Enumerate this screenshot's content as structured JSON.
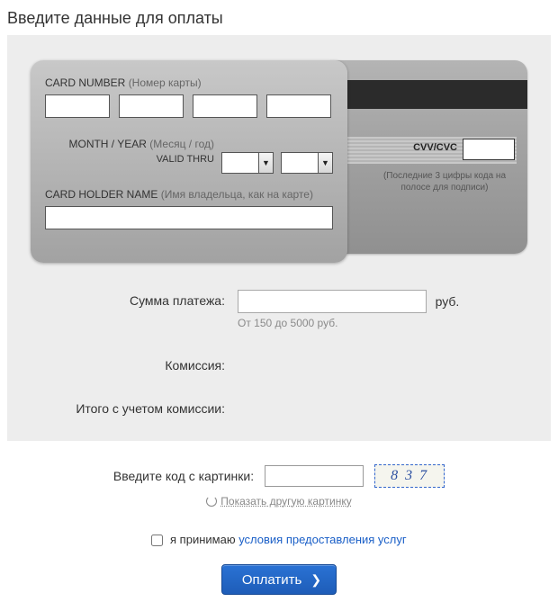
{
  "title": "Введите данные для оплаты",
  "card": {
    "number_label": "CARD NUMBER",
    "number_label_paren": "(Номер карты)",
    "number_parts": [
      "",
      "",
      "",
      ""
    ],
    "month_year_label": "MONTH / YEAR",
    "month_year_paren": "(Месяц / год)",
    "valid_thru": "VALID\nTHRU",
    "month_value": "",
    "year_value": "",
    "holder_label": "CARD HOLDER NAME",
    "holder_paren": "(Имя владельца, как на карте)",
    "holder_value": "",
    "cvv_label": "CVV/CVC",
    "cvv_value": "",
    "cvv_hint": "(Последние 3 цифры кода на полосе для подписи)"
  },
  "amount": {
    "label": "Сумма платежа:",
    "value": "",
    "currency": "руб.",
    "hint": "От 150 до 5000 руб."
  },
  "commission_label": "Комиссия:",
  "total_label": "Итого с учетом комиссии:",
  "captcha": {
    "label": "Введите код с картинки:",
    "value": "",
    "image_text": "8 3 7",
    "refresh": "Показать другую картинку"
  },
  "terms": {
    "checked": false,
    "prefix": "я принимаю ",
    "link": "условия предоставления услуг"
  },
  "pay_button": "Оплатить"
}
